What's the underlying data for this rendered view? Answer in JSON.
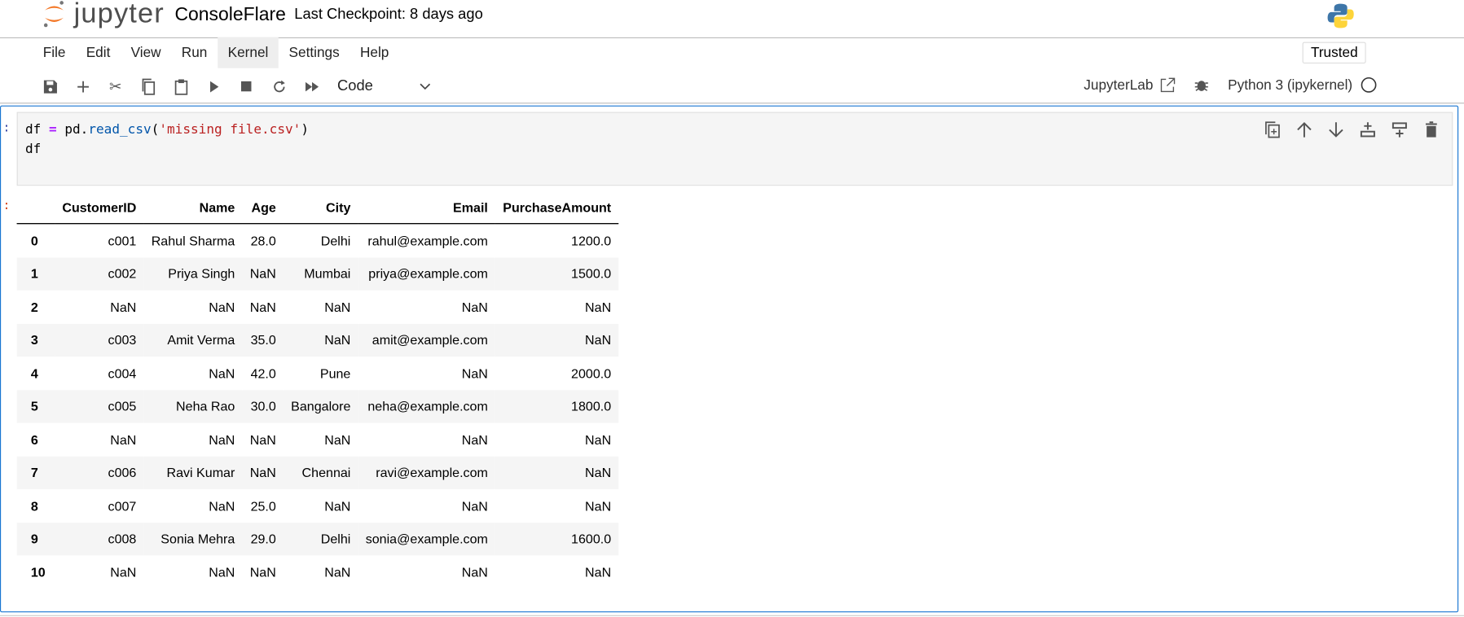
{
  "header": {
    "logo_text": "jupyter",
    "notebook_title": "ConsoleFlare",
    "checkpoint": "Last Checkpoint: 8 days ago",
    "trusted": "Trusted"
  },
  "menu": [
    "File",
    "Edit",
    "View",
    "Run",
    "Kernel",
    "Settings",
    "Help"
  ],
  "toolbar": {
    "cell_type": "Code",
    "jupyterlab_link": "JupyterLab",
    "kernel_name": "Python 3 (ipykernel)"
  },
  "cell": {
    "prompt_in": ":",
    "prompt_out": ":",
    "code_line1_var": "df",
    "code_line1_op": "=",
    "code_line1_obj": "pd.",
    "code_line1_fn": "read_csv",
    "code_line1_open": "(",
    "code_line1_str": "'missing file.csv'",
    "code_line1_close": ")",
    "code_line2": "df"
  },
  "table": {
    "columns": [
      "",
      "CustomerID",
      "Name",
      "Age",
      "City",
      "Email",
      "PurchaseAmount"
    ],
    "rows": [
      [
        "0",
        "c001",
        "Rahul Sharma",
        "28.0",
        "Delhi",
        "rahul@example.com",
        "1200.0"
      ],
      [
        "1",
        "c002",
        "Priya Singh",
        "NaN",
        "Mumbai",
        "priya@example.com",
        "1500.0"
      ],
      [
        "2",
        "NaN",
        "NaN",
        "NaN",
        "NaN",
        "NaN",
        "NaN"
      ],
      [
        "3",
        "c003",
        "Amit Verma",
        "35.0",
        "NaN",
        "amit@example.com",
        "NaN"
      ],
      [
        "4",
        "c004",
        "NaN",
        "42.0",
        "Pune",
        "NaN",
        "2000.0"
      ],
      [
        "5",
        "c005",
        "Neha Rao",
        "30.0",
        "Bangalore",
        "neha@example.com",
        "1800.0"
      ],
      [
        "6",
        "NaN",
        "NaN",
        "NaN",
        "NaN",
        "NaN",
        "NaN"
      ],
      [
        "7",
        "c006",
        "Ravi Kumar",
        "NaN",
        "Chennai",
        "ravi@example.com",
        "NaN"
      ],
      [
        "8",
        "c007",
        "NaN",
        "25.0",
        "NaN",
        "NaN",
        "NaN"
      ],
      [
        "9",
        "c008",
        "Sonia Mehra",
        "29.0",
        "Delhi",
        "sonia@example.com",
        "1600.0"
      ],
      [
        "10",
        "NaN",
        "NaN",
        "NaN",
        "NaN",
        "NaN",
        "NaN"
      ]
    ]
  }
}
